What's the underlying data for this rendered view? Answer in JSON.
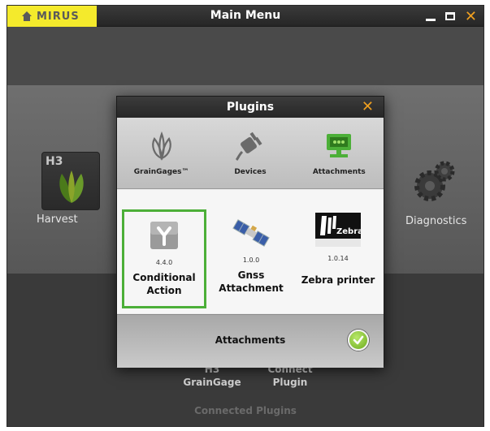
{
  "window": {
    "logo": "MIRUS",
    "title": "Main Menu",
    "controls": {
      "minimize": "—",
      "maximize": "□",
      "close": "✕"
    }
  },
  "background": {
    "apps": [
      {
        "label": "Harvest",
        "tile_text": "H3",
        "icon": "harvest-leaf-icon"
      },
      {
        "label": "Diagnostics",
        "icon": "gears-icon"
      }
    ],
    "bottom_apps": [
      {
        "label_line1": "H3",
        "label_line2": "GrainGage"
      },
      {
        "label_line1": "Connect",
        "label_line2": "Plugin"
      }
    ],
    "connected_label": "Connected Plugins"
  },
  "dialog": {
    "title": "Plugins",
    "close": "✕",
    "categories": [
      {
        "label": "GrainGages™",
        "icon": "leaf-icon"
      },
      {
        "label": "Devices",
        "icon": "plug-icon"
      },
      {
        "label": "Attachments",
        "icon": "monitor-icon"
      }
    ],
    "plugins": [
      {
        "name_line1": "Conditional",
        "name_line2": "Action",
        "version": "4.4.0",
        "selected": true,
        "icon": "y-junction-icon"
      },
      {
        "name_line1": "Gnss",
        "name_line2": "Attachment",
        "version": "1.0.0",
        "selected": false,
        "icon": "satellite-icon"
      },
      {
        "name_line1": "Zebra printer",
        "name_line2": "",
        "version": "1.0.14",
        "selected": false,
        "icon": "zebra-icon"
      }
    ],
    "footer_label": "Attachments",
    "confirm_icon": "checkmark-icon"
  },
  "colors": {
    "accent_yellow": "#f4ea2c",
    "close_orange": "#f0a020",
    "selected_green": "#4caf38"
  }
}
